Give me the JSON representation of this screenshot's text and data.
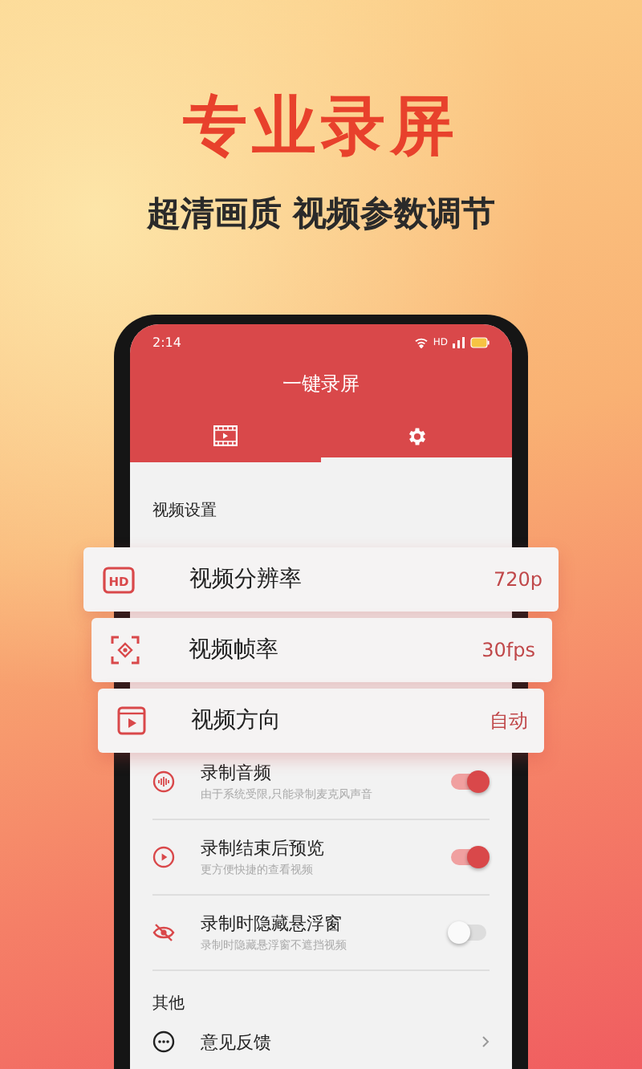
{
  "headline": "专业录屏",
  "subtitle": "超清画质 视频参数调节",
  "status_bar": {
    "time": "2:14",
    "network": "HD"
  },
  "app_bar": {
    "title": "一键录屏"
  },
  "tabs": [
    {
      "kind": "video",
      "selected": false
    },
    {
      "kind": "settings",
      "selected": true
    }
  ],
  "section_video": "视频设置",
  "video_options": [
    {
      "kind": "hd",
      "icon_text": "HD",
      "label": "视频分辨率",
      "value": "720p"
    },
    {
      "kind": "fps",
      "label": "视频帧率",
      "value": "30fps"
    },
    {
      "kind": "orientation",
      "label": "视频方向",
      "value": "自动"
    }
  ],
  "switches": [
    {
      "kind": "audio",
      "title": "录制音频",
      "description": "由于系统受限,只能录制麦克风声音",
      "on": true
    },
    {
      "kind": "preview",
      "title": "录制结束后预览",
      "description": "更方便快捷的查看视频",
      "on": true
    },
    {
      "kind": "hide",
      "title": "录制时隐藏悬浮窗",
      "description": "录制时隐藏悬浮窗不遮挡视频",
      "on": false
    }
  ],
  "section_other": "其他",
  "other_items": [
    {
      "kind": "feedback",
      "label": "意见反馈"
    }
  ]
}
